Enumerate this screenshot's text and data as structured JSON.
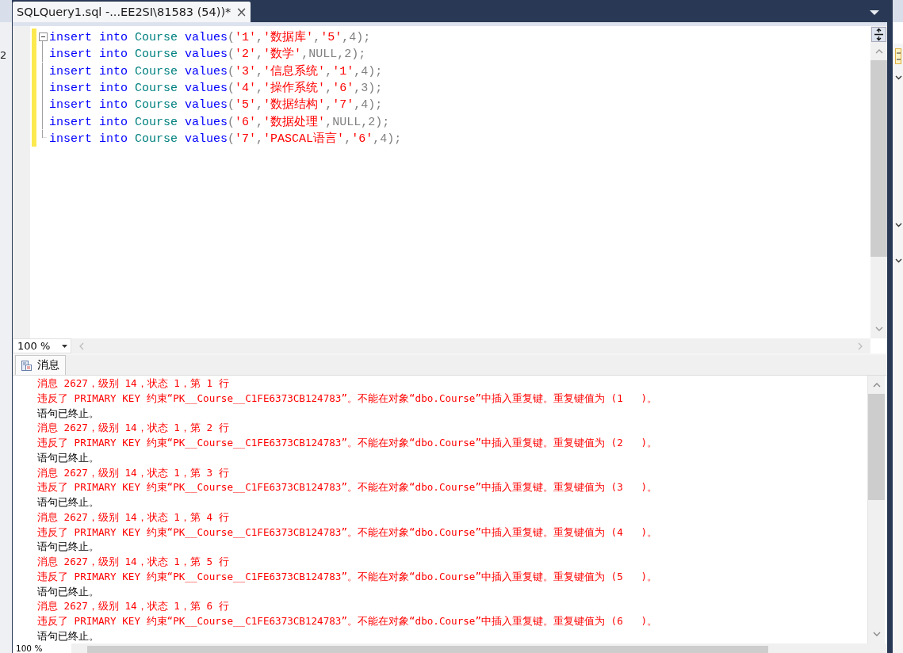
{
  "left_panel_fragment": {
    "text": "2"
  },
  "document_tab": {
    "title": "SQLQuery1.sql -...EE2SI\\81583 (54))*",
    "close": "×",
    "selected": true
  },
  "editor": {
    "lines": [
      {
        "collapsible": true,
        "tokens": [
          {
            "kind": "keyword",
            "text": "insert into "
          },
          {
            "kind": "object",
            "text": "Course "
          },
          {
            "kind": "keyword",
            "text": "values"
          },
          {
            "kind": "punct",
            "text": "("
          },
          {
            "kind": "string",
            "text": "'1'"
          },
          {
            "kind": "punct",
            "text": ","
          },
          {
            "kind": "string",
            "text": "'数据库'"
          },
          {
            "kind": "punct",
            "text": ","
          },
          {
            "kind": "string",
            "text": "'5'"
          },
          {
            "kind": "punct",
            "text": ",4);"
          }
        ]
      },
      {
        "collapsible": false,
        "tokens": [
          {
            "kind": "keyword",
            "text": "insert into "
          },
          {
            "kind": "object",
            "text": "Course "
          },
          {
            "kind": "keyword",
            "text": "values"
          },
          {
            "kind": "punct",
            "text": "("
          },
          {
            "kind": "string",
            "text": "'2'"
          },
          {
            "kind": "punct",
            "text": ","
          },
          {
            "kind": "string",
            "text": "'数学'"
          },
          {
            "kind": "punct",
            "text": ","
          },
          {
            "kind": "null",
            "text": "NULL"
          },
          {
            "kind": "punct",
            "text": ",2);"
          }
        ]
      },
      {
        "collapsible": false,
        "tokens": [
          {
            "kind": "keyword",
            "text": "insert into "
          },
          {
            "kind": "object",
            "text": "Course "
          },
          {
            "kind": "keyword",
            "text": "values"
          },
          {
            "kind": "punct",
            "text": "("
          },
          {
            "kind": "string",
            "text": "'3'"
          },
          {
            "kind": "punct",
            "text": ","
          },
          {
            "kind": "string",
            "text": "'信息系统'"
          },
          {
            "kind": "punct",
            "text": ","
          },
          {
            "kind": "string",
            "text": "'1'"
          },
          {
            "kind": "punct",
            "text": ",4);"
          }
        ]
      },
      {
        "collapsible": false,
        "tokens": [
          {
            "kind": "keyword",
            "text": "insert into "
          },
          {
            "kind": "object",
            "text": "Course "
          },
          {
            "kind": "keyword",
            "text": "values"
          },
          {
            "kind": "punct",
            "text": "("
          },
          {
            "kind": "string",
            "text": "'4'"
          },
          {
            "kind": "punct",
            "text": ","
          },
          {
            "kind": "string",
            "text": "'操作系统'"
          },
          {
            "kind": "punct",
            "text": ","
          },
          {
            "kind": "string",
            "text": "'6'"
          },
          {
            "kind": "punct",
            "text": ",3);"
          }
        ]
      },
      {
        "collapsible": false,
        "tokens": [
          {
            "kind": "keyword",
            "text": "insert into "
          },
          {
            "kind": "object",
            "text": "Course "
          },
          {
            "kind": "keyword",
            "text": "values"
          },
          {
            "kind": "punct",
            "text": "("
          },
          {
            "kind": "string",
            "text": "'5'"
          },
          {
            "kind": "punct",
            "text": ","
          },
          {
            "kind": "string",
            "text": "'数据结构'"
          },
          {
            "kind": "punct",
            "text": ","
          },
          {
            "kind": "string",
            "text": "'7'"
          },
          {
            "kind": "punct",
            "text": ",4);"
          }
        ]
      },
      {
        "collapsible": false,
        "tokens": [
          {
            "kind": "keyword",
            "text": "insert into "
          },
          {
            "kind": "object",
            "text": "Course "
          },
          {
            "kind": "keyword",
            "text": "values"
          },
          {
            "kind": "punct",
            "text": "("
          },
          {
            "kind": "string",
            "text": "'6'"
          },
          {
            "kind": "punct",
            "text": ","
          },
          {
            "kind": "string",
            "text": "'数据处理'"
          },
          {
            "kind": "punct",
            "text": ","
          },
          {
            "kind": "null",
            "text": "NULL"
          },
          {
            "kind": "punct",
            "text": ",2);"
          }
        ]
      },
      {
        "collapsible": false,
        "tokens": [
          {
            "kind": "keyword",
            "text": "insert into "
          },
          {
            "kind": "object",
            "text": "Course "
          },
          {
            "kind": "keyword",
            "text": "values"
          },
          {
            "kind": "punct",
            "text": "("
          },
          {
            "kind": "string",
            "text": "'7'"
          },
          {
            "kind": "punct",
            "text": ","
          },
          {
            "kind": "string",
            "text": "'PASCAL语言'"
          },
          {
            "kind": "punct",
            "text": ","
          },
          {
            "kind": "string",
            "text": "'6'"
          },
          {
            "kind": "punct",
            "text": ",4);"
          }
        ]
      }
    ],
    "zoom": "100 %"
  },
  "results_tab": {
    "label": "消息",
    "selected": true
  },
  "messages": [
    {
      "kind": "error",
      "text": "消息 2627，级别 14，状态 1，第 1 行"
    },
    {
      "kind": "error",
      "text": "违反了 PRIMARY KEY 约束“PK__Course__C1FE6373CB124783”。不能在对象“dbo.Course”中插入重复键。重复键值为 (1   )。"
    },
    {
      "kind": "info",
      "text": "语句已终止。"
    },
    {
      "kind": "error",
      "text": "消息 2627，级别 14，状态 1，第 2 行"
    },
    {
      "kind": "error",
      "text": "违反了 PRIMARY KEY 约束“PK__Course__C1FE6373CB124783”。不能在对象“dbo.Course”中插入重复键。重复键值为 (2   )。"
    },
    {
      "kind": "info",
      "text": "语句已终止。"
    },
    {
      "kind": "error",
      "text": "消息 2627，级别 14，状态 1，第 3 行"
    },
    {
      "kind": "error",
      "text": "违反了 PRIMARY KEY 约束“PK__Course__C1FE6373CB124783”。不能在对象“dbo.Course”中插入重复键。重复键值为 (3   )。"
    },
    {
      "kind": "info",
      "text": "语句已终止。"
    },
    {
      "kind": "error",
      "text": "消息 2627，级别 14，状态 1，第 4 行"
    },
    {
      "kind": "error",
      "text": "违反了 PRIMARY KEY 约束“PK__Course__C1FE6373CB124783”。不能在对象“dbo.Course”中插入重复键。重复键值为 (4   )。"
    },
    {
      "kind": "info",
      "text": "语句已终止。"
    },
    {
      "kind": "error",
      "text": "消息 2627，级别 14，状态 1，第 5 行"
    },
    {
      "kind": "error",
      "text": "违反了 PRIMARY KEY 约束“PK__Course__C1FE6373CB124783”。不能在对象“dbo.Course”中插入重复键。重复键值为 (5   )。"
    },
    {
      "kind": "info",
      "text": "语句已终止。"
    },
    {
      "kind": "error",
      "text": "消息 2627，级别 14，状态 1，第 6 行"
    },
    {
      "kind": "error",
      "text": "违反了 PRIMARY KEY 约束“PK__Course__C1FE6373CB124783”。不能在对象“dbo.Course”中插入重复键。重复键值为 (6   )。"
    },
    {
      "kind": "info",
      "text": "语句已终止。"
    }
  ],
  "results_zoom": "100 %"
}
